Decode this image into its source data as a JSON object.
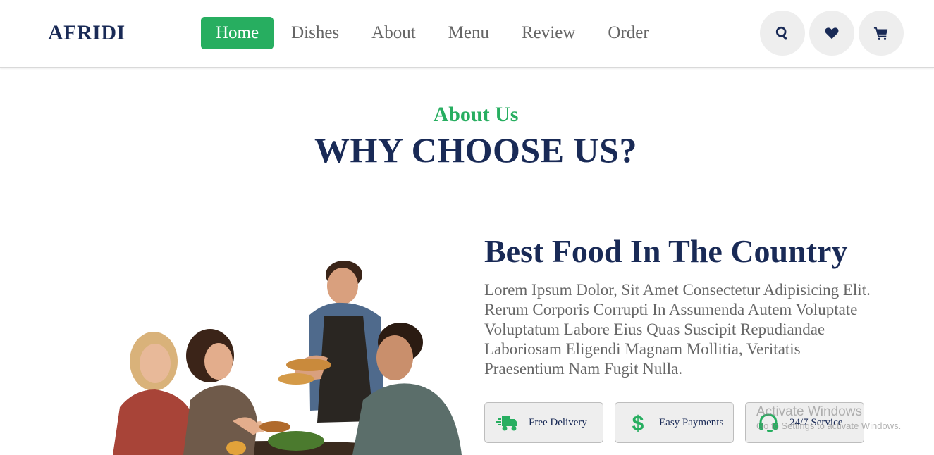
{
  "header": {
    "logo": "AFRIDI",
    "nav": [
      {
        "label": "Home",
        "active": true
      },
      {
        "label": "Dishes",
        "active": false
      },
      {
        "label": "About",
        "active": false
      },
      {
        "label": "Menu",
        "active": false
      },
      {
        "label": "Review",
        "active": false
      },
      {
        "label": "Order",
        "active": false
      }
    ],
    "icons": [
      "search-icon",
      "heart-icon",
      "cart-icon"
    ]
  },
  "about": {
    "sub_heading": "About Us",
    "heading": "WHY CHOOSE US?",
    "title": "Best Food In The Country",
    "text": "Lorem Ipsum Dolor, Sit Amet Consectetur Adipisicing Elit. Rerum Corporis Corrupti In Assumenda Autem Voluptate Voluptatum Labore Eius Quas Suscipit Repudiandae Laboriosam Eligendi Magnam Mollitia, Veritatis Praesentium Nam Fugit Nulla.",
    "features": [
      {
        "icon": "truck-icon",
        "label": "Free Delivery"
      },
      {
        "icon": "dollar-icon",
        "label": "Easy Payments"
      },
      {
        "icon": "headset-icon",
        "label": "24/7 Service"
      }
    ]
  },
  "watermark": {
    "line1": "Activate Windows",
    "line2": "Go to Settings to activate Windows."
  },
  "colors": {
    "accent": "#27ae60",
    "primary": "#192a56",
    "text": "#666666",
    "light": "#eeeeee"
  }
}
